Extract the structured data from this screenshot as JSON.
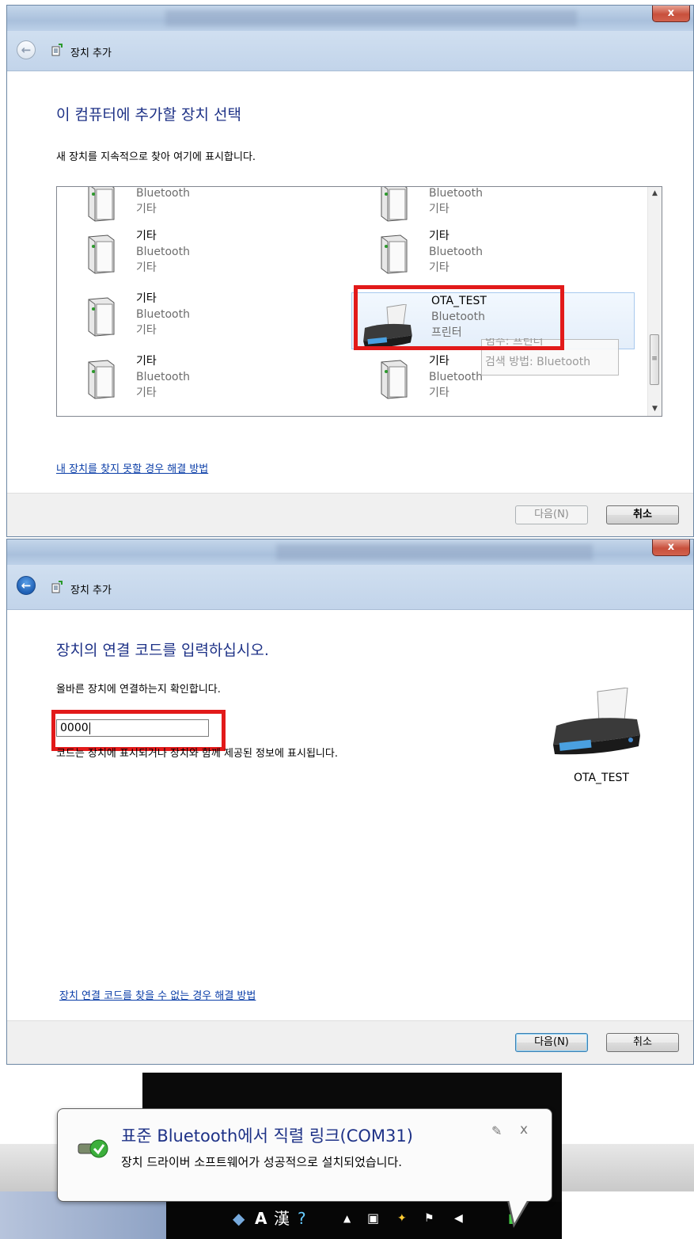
{
  "dialog1": {
    "close_label": "x",
    "nav_title": "장치 추가",
    "heading": "이 컴퓨터에 추가할 장치 선택",
    "subtitle": "새 장치를 지속적으로 찾아 여기에 표시합니다.",
    "devices": [
      {
        "name": "",
        "type1": "Bluetooth",
        "type2": "기타",
        "icon": "generic-device-icon"
      },
      {
        "name": "",
        "type1": "Bluetooth",
        "type2": "기타",
        "icon": "generic-device-icon"
      },
      {
        "name": "기타",
        "type1": "Bluetooth",
        "type2": "기타",
        "icon": "generic-device-icon"
      },
      {
        "name": "기타",
        "type1": "Bluetooth",
        "type2": "기타",
        "icon": "generic-device-icon"
      },
      {
        "name": "기타",
        "type1": "Bluetooth",
        "type2": "기타",
        "icon": "generic-device-icon"
      },
      {
        "name": "OTA_TEST",
        "type1": "Bluetooth",
        "type2": "프린터",
        "icon": "printer-icon",
        "selected": true
      },
      {
        "name": "기타",
        "type1": "Bluetooth",
        "type2": "기타",
        "icon": "generic-device-icon"
      },
      {
        "name": "기타",
        "type1": "Bluetooth",
        "type2": "기타",
        "icon": "generic-device-icon"
      }
    ],
    "tooltip": {
      "line1": "범주: 프린터",
      "line2": "검색 방법: Bluetooth"
    },
    "help_link": "내 장치를 찾지 못할 경우 해결 방법",
    "next_label": "다음(N)",
    "cancel_label": "취소"
  },
  "dialog2": {
    "close_label": "x",
    "nav_title": "장치 추가",
    "heading": "장치의 연결 코드를 입력하십시오.",
    "subtitle": "올바른 장치에 연결하는지 확인합니다.",
    "code_value": "0000",
    "code_hint": "코드는 장치에 표시되거나 장치와 함께 제공된 정보에 표시됩니다.",
    "device_name": "OTA_TEST",
    "help_link": "장치 연결 코드를 찾을 수 없는 경우 해결 방법",
    "next_label": "다음(N)",
    "cancel_label": "취소"
  },
  "notification": {
    "title": "표준 Bluetooth에서 직렬 링크(COM31)",
    "message": "장치 드라이버 소프트웨어가 성공적으로 설치되었습니다.",
    "close_label": "x"
  },
  "tray": {
    "lang_a": "A",
    "lang_han": "漢"
  },
  "colors": {
    "heading": "#1e3287",
    "highlight": "#e21a1a",
    "link": "#0b3ea8"
  }
}
